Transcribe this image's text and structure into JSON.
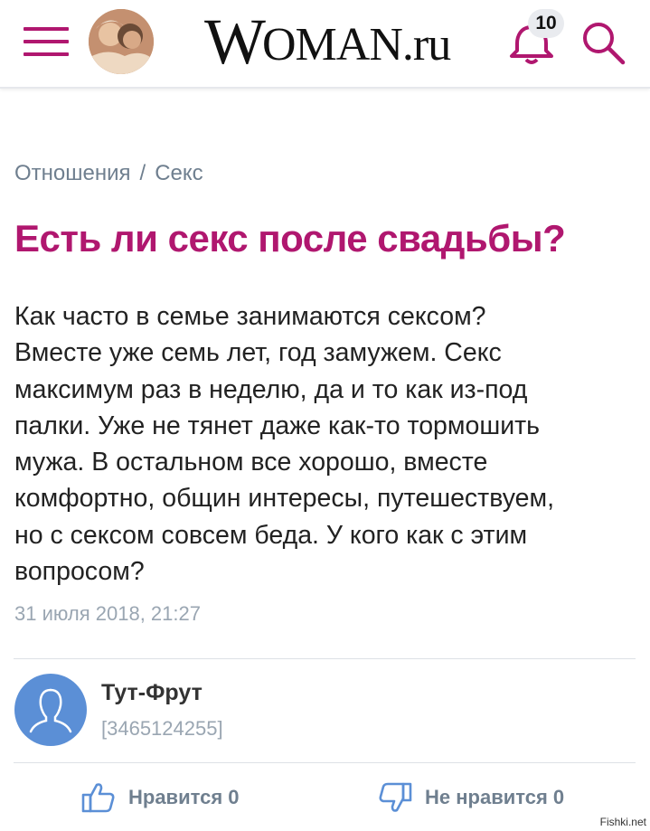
{
  "header": {
    "logo_w": "W",
    "logo_rest": "OMAN.ru",
    "notifications_count": "10",
    "icons": [
      "menu-icon",
      "bell-icon",
      "search-icon"
    ],
    "accent_color": "#b0176f"
  },
  "breadcrumb": {
    "section": "Отношения",
    "separator": "/",
    "subsection": "Секс"
  },
  "article": {
    "title": "Есть ли секс после свадьбы?",
    "lines": [
      "Как часто в семье занимаются сексом?",
      "Вместе уже семь лет, год замужем. Секс",
      "максимум раз в неделю, да и то как из-под",
      "палки. Уже не тянет даже как-то тормошить",
      "мужа. В остальном все хорошо, вместе",
      "комфортно, общин интересы, путешествуем,",
      "но с сексом совсем беда. У кого как с этим",
      "вопросом?"
    ],
    "date": "31 июля 2018, 21:27"
  },
  "author": {
    "name": "Тут-Фрут",
    "id": "[3465124255]"
  },
  "votes": {
    "like_label": "Нравится 0",
    "dislike_label": "Не нравится 0"
  },
  "watermark": "Fishki.net"
}
